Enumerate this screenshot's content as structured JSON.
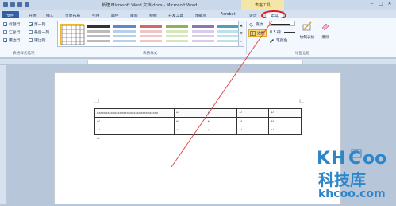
{
  "window": {
    "title": "新建 Microsoft Word 文档.docx - Microsoft Word",
    "context_tab_group": "表格工具",
    "window_controls": [
      "minimize-icon",
      "maximize-icon",
      "close-icon"
    ]
  },
  "tabs": [
    {
      "label": "文件"
    },
    {
      "label": "开始"
    },
    {
      "label": "插入"
    },
    {
      "label": "页面布局"
    },
    {
      "label": "引用"
    },
    {
      "label": "邮件"
    },
    {
      "label": "审阅"
    },
    {
      "label": "视图"
    },
    {
      "label": "开发工具"
    },
    {
      "label": "加载项"
    },
    {
      "label": "Acrobat"
    },
    {
      "label": "设计"
    },
    {
      "label": "布局"
    }
  ],
  "ribbon": {
    "style_options": {
      "label": "表格样式选项",
      "options": [
        {
          "label": "标题行",
          "checked": true
        },
        {
          "label": "第一列",
          "checked": true
        },
        {
          "label": "汇总行",
          "checked": false
        },
        {
          "label": "最后一列",
          "checked": false
        },
        {
          "label": "镶边行",
          "checked": true
        },
        {
          "label": "镶边列",
          "checked": false
        }
      ]
    },
    "table_styles": {
      "label": "表格样式",
      "scroll_up": "▲",
      "scroll_down": "▼",
      "more": "▾"
    },
    "borders": {
      "shading": "底纹",
      "borders": "边框",
      "pen_weight": "0.5 磅",
      "pen_color": "笔颜色",
      "draw_table": "绘制表格",
      "eraser": "擦除",
      "label": "绘图边框"
    }
  },
  "document": {
    "para_mark": "↵",
    "first_cell_text": "aaaaaaaaaaaaaaaaaaaaaaaaaaaaaaaaaaa",
    "rows": 3,
    "cols": 5
  },
  "watermark": {
    "logo_letters": [
      "K",
      "H",
      "C",
      "oo"
    ],
    "name": "科技库",
    "url": "khcoo.com"
  },
  "colors": {
    "accent": "#2f5fa7",
    "highlight_oval": "#e21818",
    "diagonal_line": "#e24a4a",
    "watermark_blue": "#2d86c9"
  }
}
